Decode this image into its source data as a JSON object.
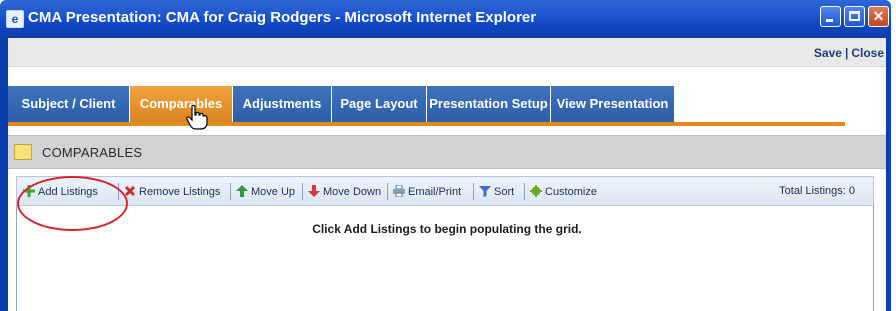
{
  "window": {
    "title": "CMA Presentation: CMA for Craig Rodgers - Microsoft Internet Explorer",
    "icon": "ie-icon"
  },
  "topbar": {
    "save_label": "Save",
    "separator": "|",
    "close_label": "Close"
  },
  "tabs": [
    {
      "label": "Subject / Client",
      "active": false
    },
    {
      "label": "Comparables",
      "active": true
    },
    {
      "label": "Adjustments",
      "active": false
    },
    {
      "label": "Page Layout",
      "active": false
    },
    {
      "label": "Presentation Setup",
      "active": false
    },
    {
      "label": "View Presentation",
      "active": false
    }
  ],
  "panel": {
    "title": "COMPARABLES"
  },
  "toolbar": {
    "items": [
      {
        "label": "Add Listings",
        "icon": "plus-icon",
        "color": "#3aa33a"
      },
      {
        "label": "Remove Listings",
        "icon": "x-icon",
        "color": "#cc2a2a"
      },
      {
        "label": "Move Up",
        "icon": "arrow-up-icon",
        "color": "#2f9a3a"
      },
      {
        "label": "Move Down",
        "icon": "arrow-down-icon",
        "color": "#d23b3b"
      },
      {
        "label": "Email/Print",
        "icon": "printer-icon",
        "color": "#5a6f8f"
      },
      {
        "label": "Sort",
        "icon": "funnel-icon",
        "color": "#3d6fc9"
      },
      {
        "label": "Customize",
        "icon": "gear-icon",
        "color": "#6aa62a"
      }
    ],
    "total_listings": "Total Listings: 0"
  },
  "grid": {
    "empty_message": "Click Add Listings to begin populating the grid."
  },
  "colors": {
    "titlebar": "#1f58d0",
    "tab": "#3468b4",
    "tab_active": "#e8942f",
    "highlight": "#d9232a"
  }
}
